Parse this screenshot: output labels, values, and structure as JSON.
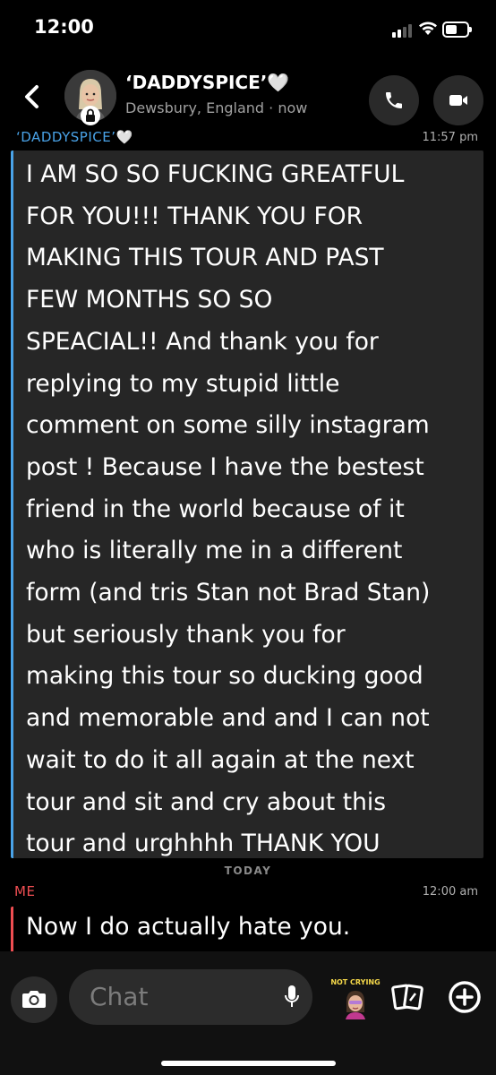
{
  "status_bar": {
    "time": "12:00"
  },
  "header": {
    "contact_name": "‘DADDYSPICE’🤍",
    "subtitle": "Dewsbury, England · now"
  },
  "messages": [
    {
      "sender": "‘DADDYSPICE’🤍",
      "time": "11:57 pm",
      "lines": [
        "I AM SO SO FUCKING GREATFUL",
        "FOR YOU!!! THANK YOU FOR",
        "MAKING THIS TOUR AND PAST",
        "FEW MONTHS SO SO",
        "SPEACIAL!! And thank you for",
        "replying to my stupid little",
        "comment on some silly instagram",
        "post ! Because I have the bestest",
        "friend in the world because of it",
        "who is literally me in a different",
        "form (and tris Stan not Brad Stan)",
        "but seriously thank you for",
        "making this tour so ducking good",
        "and memorable and and I can not",
        "wait to do it all again at the next",
        "tour and sit and cry about this",
        "tour and urghhhh THANK YOU"
      ]
    },
    {
      "sender": "ME",
      "time": "12:00 am",
      "lines": [
        "Now I do actually hate you."
      ]
    }
  ],
  "divider": "TODAY",
  "composer": {
    "placeholder": "Chat",
    "bitmoji_label": "NOT CRYING"
  },
  "colors": {
    "friend_accent": "#4aa3e8",
    "me_accent": "#ef4e52",
    "bubble_bg": "#262626"
  },
  "icons": [
    "back-chevron-icon",
    "lock-icon",
    "phone-icon",
    "video-icon",
    "camera-icon",
    "mic-icon",
    "bitmoji-sticker",
    "cards-icon",
    "plus-icon"
  ]
}
